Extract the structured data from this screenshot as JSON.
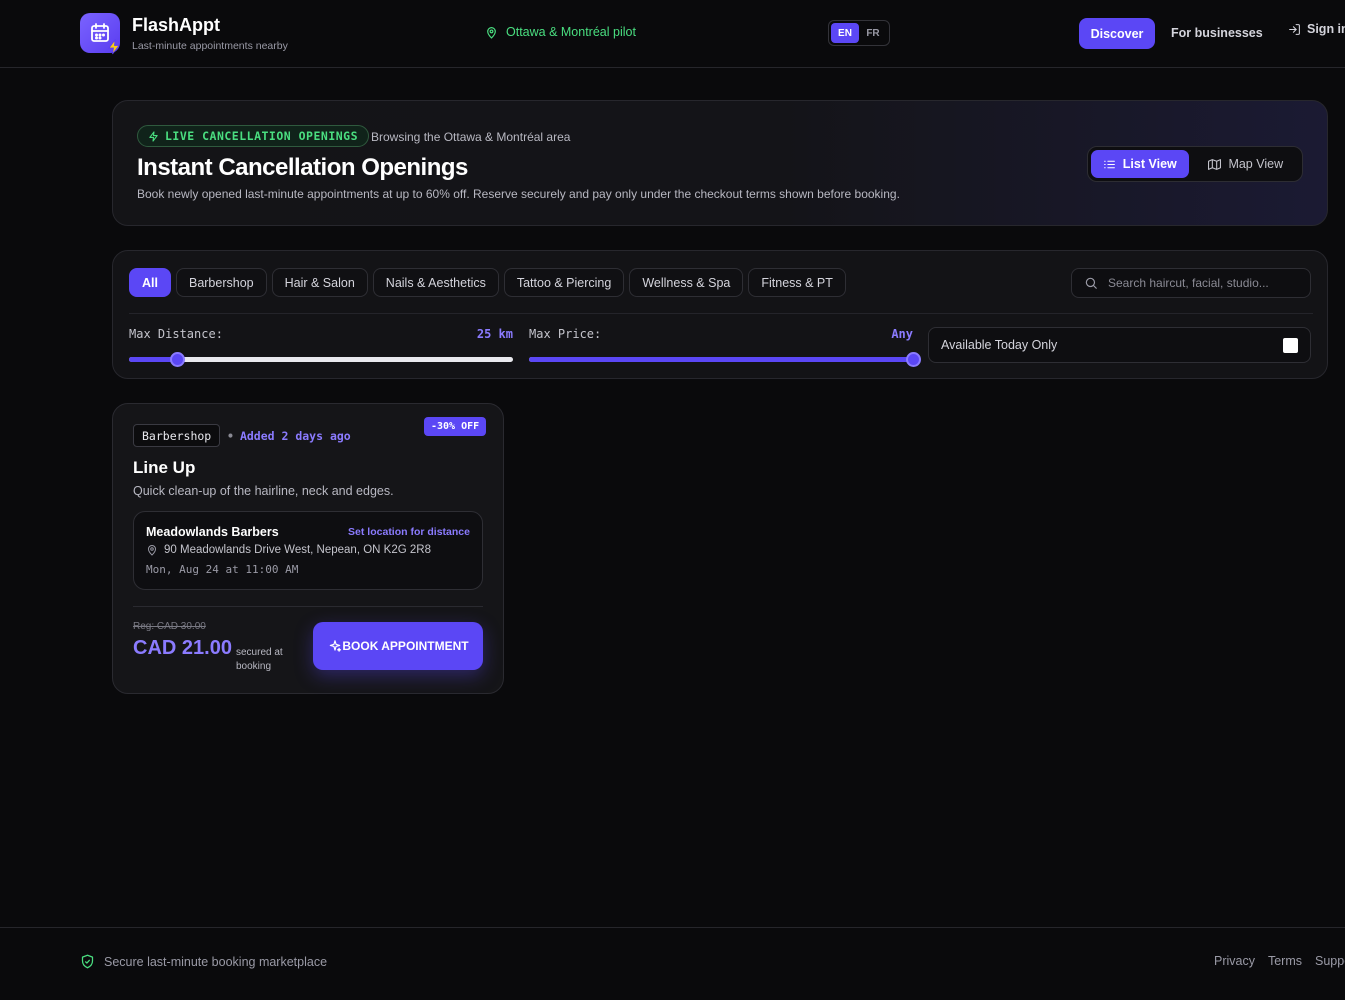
{
  "header": {
    "brand_name": "FlashAppt",
    "brand_tagline": "Last-minute appointments nearby",
    "region": "Ottawa & Montréal pilot",
    "languages": [
      "EN",
      "FR"
    ],
    "active_language": "EN",
    "nav": {
      "discover": "Discover",
      "for_businesses": "For businesses",
      "sign_in": "Sign in"
    }
  },
  "hero": {
    "badge": "LIVE CANCELLATION OPENINGS",
    "browsing": "Browsing the Ottawa & Montréal area",
    "title": "Instant Cancellation Openings",
    "description": "Book newly opened last-minute appointments at up to 60% off. Reserve securely and pay only under the checkout terms shown before booking.",
    "view_toggle": {
      "list": "List View",
      "map": "Map View",
      "active": "list"
    }
  },
  "filters": {
    "categories": [
      "All",
      "Barbershop",
      "Hair & Salon",
      "Nails & Aesthetics",
      "Tattoo & Piercing",
      "Wellness & Spa",
      "Fitness & PT"
    ],
    "active_category": "All",
    "search_placeholder": "Search haircut, facial, studio...",
    "max_distance": {
      "label": "Max Distance:",
      "value_label": "25 km",
      "value": 25,
      "min": 0,
      "max": 200
    },
    "max_price": {
      "label": "Max Price:",
      "value_label": "Any",
      "fraction": 1.0
    },
    "available_today": {
      "label": "Available Today Only",
      "checked": false
    }
  },
  "listings": [
    {
      "category": "Barbershop",
      "added": "Added 2 days ago",
      "discount": "-30% OFF",
      "title": "Line Up",
      "description": "Quick clean-up of the hairline, neck and edges.",
      "business": "Meadowlands Barbers",
      "set_location": "Set location for distance",
      "address": "90 Meadowlands Drive West, Nepean, ON K2G 2R8",
      "datetime": "Mon, Aug 24 at 11:00 AM",
      "regular_price": "Reg: CAD 30.00",
      "price": "CAD 21.00",
      "price_note": "secured at booking",
      "book_label": "BOOK APPOINTMENT"
    }
  ],
  "footer": {
    "tagline": "Secure last-minute booking marketplace",
    "links": [
      "Privacy",
      "Terms",
      "Support"
    ]
  },
  "colors": {
    "accent": "#5b47f5",
    "accent_text": "#8b7bff",
    "live_green": "#4ade80",
    "background": "#0a0a0c"
  }
}
